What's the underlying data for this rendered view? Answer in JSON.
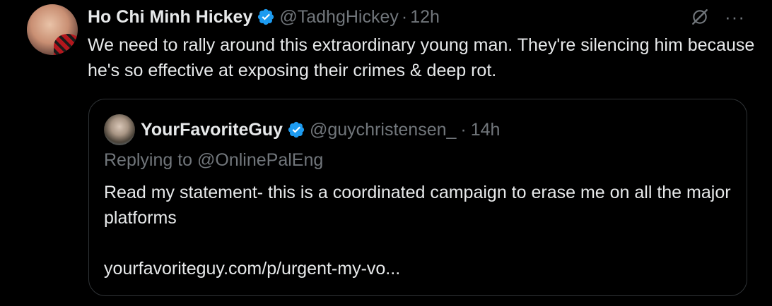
{
  "tweet": {
    "author_name": "Ho Chi Minh Hickey",
    "handle": "@TadhgHickey",
    "separator": "·",
    "time": "12h",
    "text": "We need to rally around this extraordinary young man. They're silencing him because he's so effective at exposing their crimes & deep rot.",
    "more_label": "···"
  },
  "quote": {
    "author_name": "YourFavoriteGuy",
    "handle": "@guychristensen_",
    "separator": "·",
    "time": "14h",
    "reply_line": "Replying to @OnlinePalEng",
    "text": "Read my statement- this is a coordinated campaign to erase me on all the major platforms",
    "link": "yourfavoriteguy.com/p/urgent-my-vo..."
  },
  "colors": {
    "background": "#000000",
    "primary_text": "#e7e9ea",
    "secondary_text": "#71767b",
    "verified_blue": "#1d9bf0",
    "border": "#2f3336"
  },
  "icons": [
    "verified-badge-icon",
    "grok-icon",
    "more-options-icon"
  ]
}
